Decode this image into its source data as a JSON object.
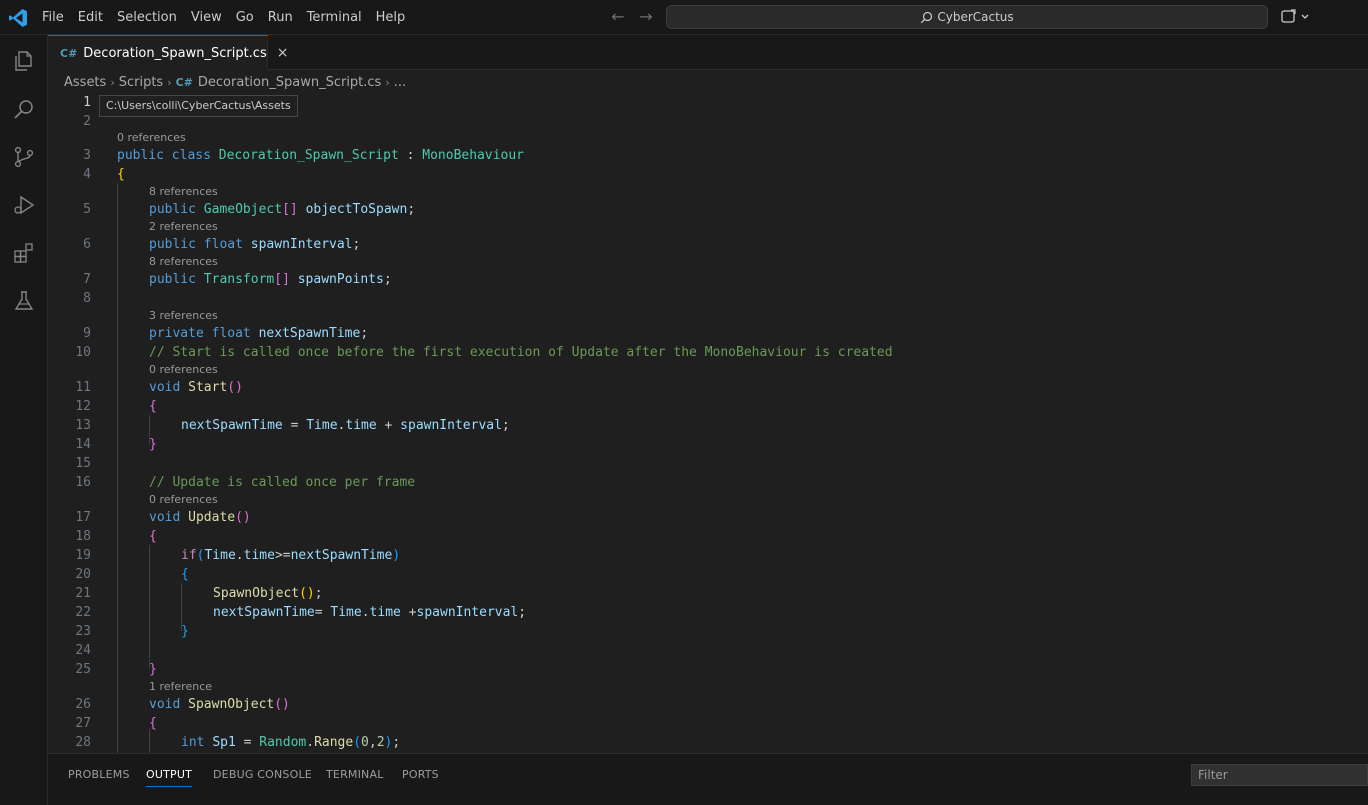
{
  "menu": [
    "File",
    "Edit",
    "Selection",
    "View",
    "Go",
    "Run",
    "Terminal",
    "Help"
  ],
  "search": {
    "text": "CyberCactus"
  },
  "tab": {
    "label": "Decoration_Spawn_Script.cs",
    "icon": "C#"
  },
  "breadcrumb": {
    "items": [
      "Assets",
      "Scripts",
      "Decoration_Spawn_Script.cs",
      "..."
    ]
  },
  "tooltip": "C:\\Users\\colli\\CyberCactus\\Assets",
  "code_lines": [
    {
      "n": "1",
      "lens": ""
    },
    {
      "n": "2",
      "lens": ""
    },
    {
      "n": "3",
      "lens": "0 references"
    },
    {
      "n": "4",
      "lens": ""
    },
    {
      "n": "5",
      "lens": "8 references"
    },
    {
      "n": "6",
      "lens": "2 references"
    },
    {
      "n": "7",
      "lens": "8 references"
    },
    {
      "n": "8",
      "lens": ""
    },
    {
      "n": "9",
      "lens": "3 references"
    },
    {
      "n": "10",
      "lens": ""
    },
    {
      "n": "11",
      "lens": "0 references"
    },
    {
      "n": "12",
      "lens": ""
    },
    {
      "n": "13",
      "lens": ""
    },
    {
      "n": "14",
      "lens": ""
    },
    {
      "n": "15",
      "lens": ""
    },
    {
      "n": "16",
      "lens": ""
    },
    {
      "n": "17",
      "lens": "0 references"
    },
    {
      "n": "18",
      "lens": ""
    },
    {
      "n": "19",
      "lens": ""
    },
    {
      "n": "20",
      "lens": ""
    },
    {
      "n": "21",
      "lens": ""
    },
    {
      "n": "22",
      "lens": ""
    },
    {
      "n": "23",
      "lens": ""
    },
    {
      "n": "24",
      "lens": ""
    },
    {
      "n": "25",
      "lens": ""
    },
    {
      "n": "26",
      "lens": "1 reference"
    },
    {
      "n": "27",
      "lens": ""
    },
    {
      "n": "28",
      "lens": ""
    }
  ],
  "code_tokens": {
    "l3": [
      "public",
      "class",
      "Decoration_Spawn_Script",
      ":",
      "MonoBehaviour"
    ],
    "l4": [
      "{"
    ],
    "l5": [
      "public",
      "GameObject",
      "[]",
      "objectToSpawn",
      ";"
    ],
    "l6": [
      "public",
      "float",
      "spawnInterval",
      ";"
    ],
    "l7": [
      "public",
      "Transform",
      "[]",
      "spawnPoints",
      ";"
    ],
    "l9": [
      "private",
      "float",
      "nextSpawnTime",
      ";"
    ],
    "l10": [
      "// Start is called once before the first execution of Update after the MonoBehaviour is created"
    ],
    "l11": [
      "void",
      "Start",
      "()"
    ],
    "l12": [
      "{"
    ],
    "l13": [
      "nextSpawnTime",
      " = ",
      "Time",
      ".",
      "time",
      " + ",
      "spawnInterval",
      ";"
    ],
    "l14": [
      "}"
    ],
    "l16": [
      "// Update is called once per frame"
    ],
    "l17": [
      "void",
      "Update",
      "()"
    ],
    "l18": [
      "{"
    ],
    "l19": [
      "if",
      "(",
      "Time",
      ".",
      "time",
      ">=",
      "nextSpawnTime",
      ")"
    ],
    "l20": [
      "{"
    ],
    "l21": [
      "SpawnObject",
      "()",
      ";"
    ],
    "l22": [
      "nextSpawnTime",
      "= ",
      "Time",
      ".",
      "time",
      " +",
      "spawnInterval",
      ";"
    ],
    "l23": [
      "}"
    ],
    "l25": [
      "}"
    ],
    "l26": [
      "void",
      "SpawnObject",
      "()"
    ],
    "l27": [
      "{"
    ],
    "l28": [
      "int",
      "Sp1",
      " = ",
      "Random",
      ".",
      "Range",
      "(",
      "0",
      ",",
      "2",
      ")",
      ";"
    ]
  },
  "panel_tabs": [
    "PROBLEMS",
    "OUTPUT",
    "DEBUG CONSOLE",
    "TERMINAL",
    "PORTS"
  ],
  "panel_active": "OUTPUT",
  "filter": {
    "placeholder": "Filter"
  },
  "colors": {
    "accent": "#0078d4",
    "editor_bg": "#1f1f1f",
    "chrome_bg": "#181818"
  },
  "icons": [
    "vscode-logo",
    "back-arrow-icon",
    "forward-arrow-icon",
    "search-icon",
    "copilot-icon",
    "explorer-icon",
    "search-view-icon",
    "source-control-icon",
    "run-debug-icon",
    "extensions-icon",
    "testing-icon",
    "close-icon",
    "lightbulb-icon"
  ]
}
